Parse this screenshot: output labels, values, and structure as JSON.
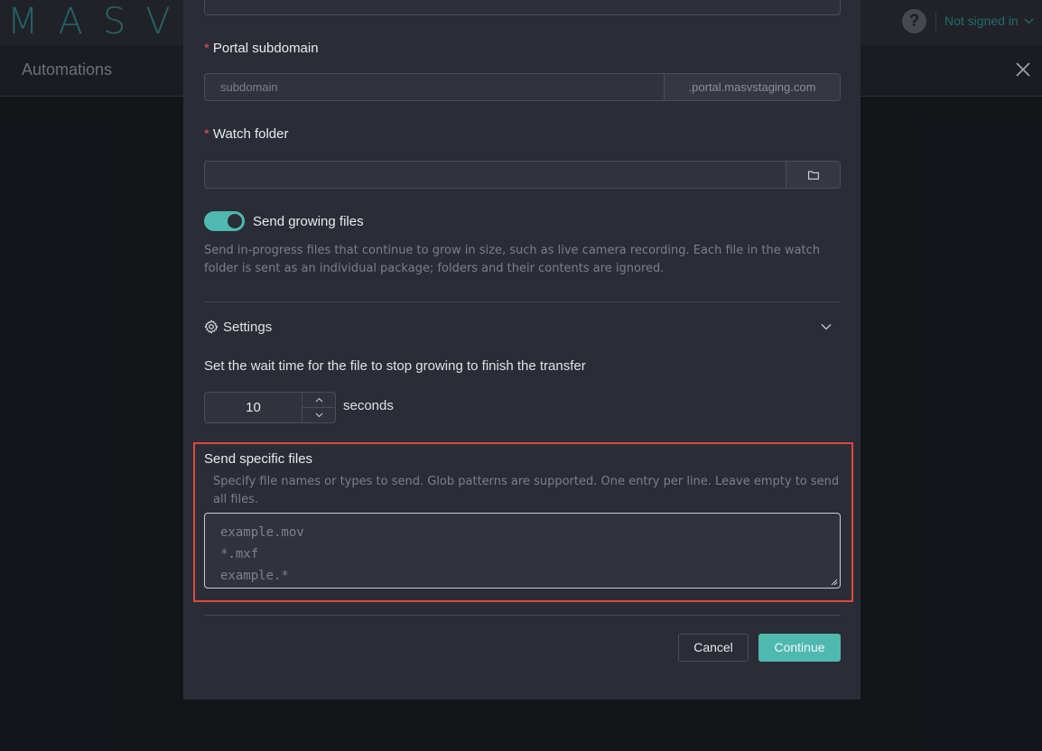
{
  "app": {
    "logo": "MASV",
    "user_status": "Not signed in",
    "page_title": "Automations"
  },
  "form": {
    "portal_subdomain": {
      "label": "Portal subdomain",
      "placeholder": "subdomain",
      "suffix": ".portal.masvstaging.com"
    },
    "watch_folder": {
      "label": "Watch folder",
      "value": ""
    },
    "growing_files": {
      "label": "Send growing files",
      "enabled": true,
      "help": "Send in-progress files that continue to grow in size, such as live camera recording. Each file in the watch folder is sent as an individual package; folders and their contents are ignored."
    },
    "settings": {
      "label": "Settings",
      "wait_text": "Set the wait time for the file to stop growing to finish the transfer",
      "wait_value": "10",
      "wait_unit": "seconds"
    },
    "specific_files": {
      "label": "Send specific files",
      "help": "Specify file names or types to send. Glob patterns are supported. One entry per line. Leave empty to send all files.",
      "placeholder_lines": [
        "example.mov",
        "*.mxf",
        "example.*"
      ]
    }
  },
  "actions": {
    "cancel": "Cancel",
    "continue": "Continue"
  },
  "colors": {
    "accent": "#4fb8b0",
    "required": "#e0534f",
    "highlight_border": "#e0473c"
  }
}
